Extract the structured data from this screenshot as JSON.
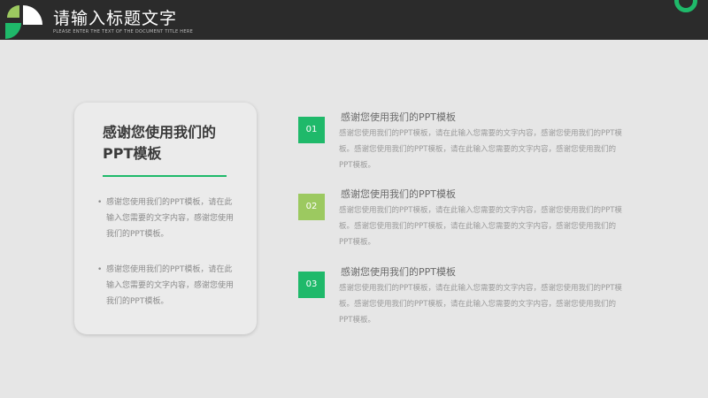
{
  "header": {
    "title": "请输入标题文字",
    "subtitle": "PLEASE ENTER THE TEXT OF THE DOCUMENT TITLE HERE"
  },
  "colors": {
    "accent": "#1fb96a",
    "accent_light": "#9cc960",
    "header_bg": "#2b2b2b",
    "background": "#e6e6e6"
  },
  "card": {
    "title": "感谢您使用我们的PPT模板",
    "bullets": [
      "感谢您使用我们的PPT模板，请在此输入您需要的文字内容，感谢您使用我们的PPT模板。",
      "感谢您使用我们的PPT模板，请在此输入您需要的文字内容，感谢您使用我们的PPT模板。"
    ]
  },
  "items": [
    {
      "number": "01",
      "title": "感谢您使用我们的PPT模板",
      "text": "感谢您使用我们的PPT模板，请在此输入您需要的文字内容，感谢您使用我们的PPT模板。感谢您使用我们的PPT模板，请在此输入您需要的文字内容，感谢您使用我们的PPT模板。",
      "color": "#1fb96a"
    },
    {
      "number": "02",
      "title": "感谢您使用我们的PPT模板",
      "text": "感谢您使用我们的PPT模板，请在此输入您需要的文字内容，感谢您使用我们的PPT模板。感谢您使用我们的PPT模板，请在此输入您需要的文字内容，感谢您使用我们的PPT模板。",
      "color": "#9cc960"
    },
    {
      "number": "03",
      "title": "感谢您使用我们的PPT模板",
      "text": "感谢您使用我们的PPT模板，请在此输入您需要的文字内容，感谢您使用我们的PPT模板。感谢您使用我们的PPT模板，请在此输入您需要的文字内容，感谢您使用我们的PPT模板。",
      "color": "#1fb96a"
    }
  ]
}
